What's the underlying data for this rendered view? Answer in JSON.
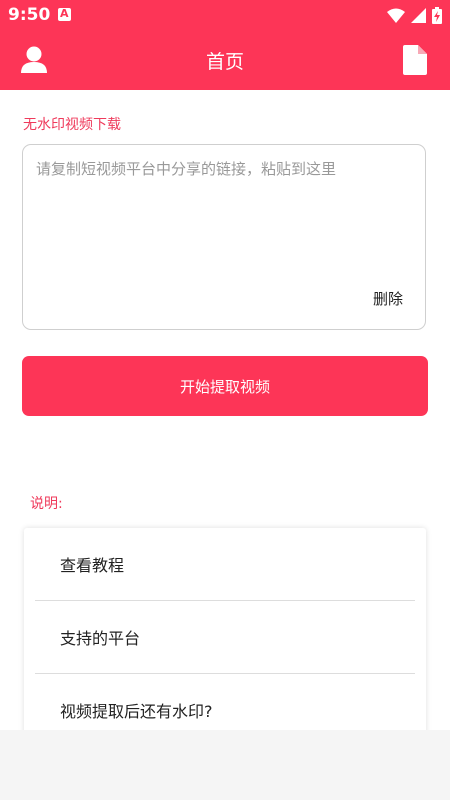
{
  "status_bar": {
    "time": "9:50",
    "notification_letter": "A",
    "icons": [
      "wifi-icon",
      "signal-icon",
      "battery-charging-icon"
    ]
  },
  "app_bar": {
    "title": "首页",
    "left_icon": "user-icon",
    "right_icon": "document-icon"
  },
  "main": {
    "section_label": "无水印视频下载",
    "link_input": {
      "placeholder": "请复制短视频平台中分享的链接，粘贴到这里",
      "value": ""
    },
    "delete_label": "删除",
    "start_button_label": "开始提取视频",
    "notes_label": "说明:",
    "help_items": [
      {
        "label": "查看教程"
      },
      {
        "label": "支持的平台"
      },
      {
        "label": "视频提取后还有水印?"
      }
    ]
  },
  "colors": {
    "accent": "#fd3557",
    "label_red": "#ef3a5b",
    "background": "#f5f5f5"
  }
}
